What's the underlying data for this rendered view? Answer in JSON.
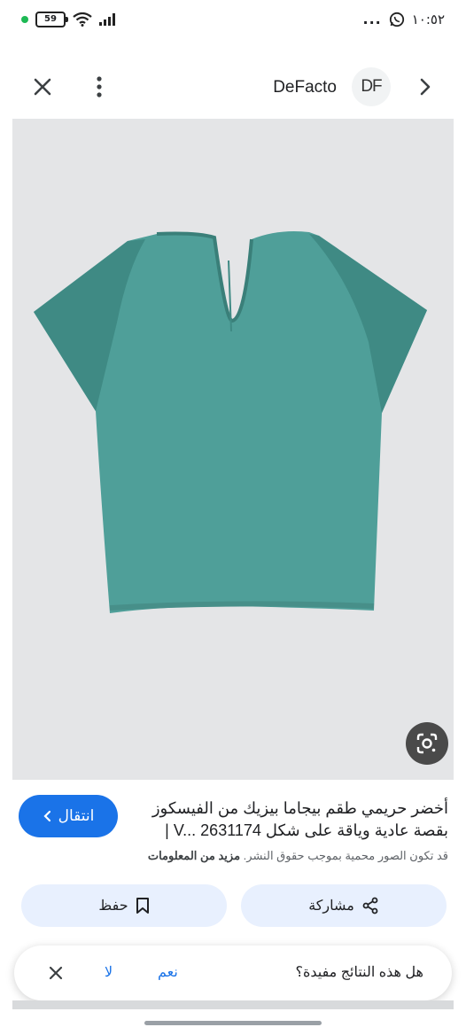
{
  "status_bar": {
    "battery": "59",
    "time": "١٠:٥٢",
    "dots": "..."
  },
  "top_bar": {
    "brand_name": "DeFacto",
    "brand_logo_text": "DF",
    "icons": [
      "close-icon",
      "more-vert-icon",
      "chevron-right-icon"
    ]
  },
  "image": {
    "subject": "product-photo",
    "colors": {
      "background": "#e4e5e7",
      "garment": "#4f9f99",
      "garment_shade": "#3f8a84"
    }
  },
  "info": {
    "title_line1": "أخضر حريمي طقم بيجاما بيزيك من الفيسكوز",
    "title_line2": "بقصة عادية وياقة على شكل V... 2631174 |",
    "visit_label": "انتقال",
    "copyright_text": "قد تكون الصور محمية بموجب حقوق النشر.",
    "learn_more": "مزيد من المعلومات"
  },
  "actions": {
    "share_label": "مشاركة",
    "save_label": "حفظ"
  },
  "feedback": {
    "question": "هل هذه النتائج مفيدة؟",
    "yes_label": "نعم",
    "no_label": "لا"
  },
  "colors": {
    "accent": "#1a73e8",
    "action_bg": "#e8f0fe"
  }
}
